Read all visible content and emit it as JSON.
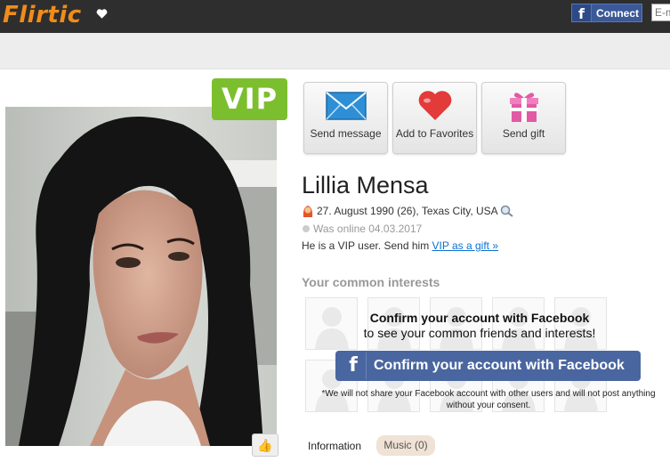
{
  "header": {
    "logo_text": "Flirtic",
    "fb_connect_label": "Connect",
    "email_placeholder": "E-m"
  },
  "profile": {
    "vip_badge": "VIP",
    "name": "Lillia Mensa",
    "birth_info": "27. August 1990 (26), Texas City, USA",
    "online_status": "Was online 04.03.2017",
    "vip_text": "He is a VIP user. Send him",
    "vip_link": "VIP as a gift »"
  },
  "actions": [
    {
      "label": "Send message",
      "icon": "envelope-icon"
    },
    {
      "label": "Add to Favorites",
      "icon": "heart-icon"
    },
    {
      "label": "Send gift",
      "icon": "gift-icon"
    }
  ],
  "interests": {
    "title": "Your common interests",
    "confirm_title": "Confirm your account with Facebook",
    "confirm_sub": "to see your common friends and interests!",
    "fb_button_label": "Confirm your account with Facebook",
    "disclaimer": "*We will not share your Facebook account with other users and will not post anything without your consent."
  },
  "tabs": {
    "information": "Information",
    "music": "Music (0)"
  },
  "colors": {
    "topbar": "#2e2e2e",
    "logo": "#f08c1a",
    "vip_green": "#7cbf2e",
    "facebook_blue": "#4a66a0",
    "link_blue": "#0a70d4"
  }
}
